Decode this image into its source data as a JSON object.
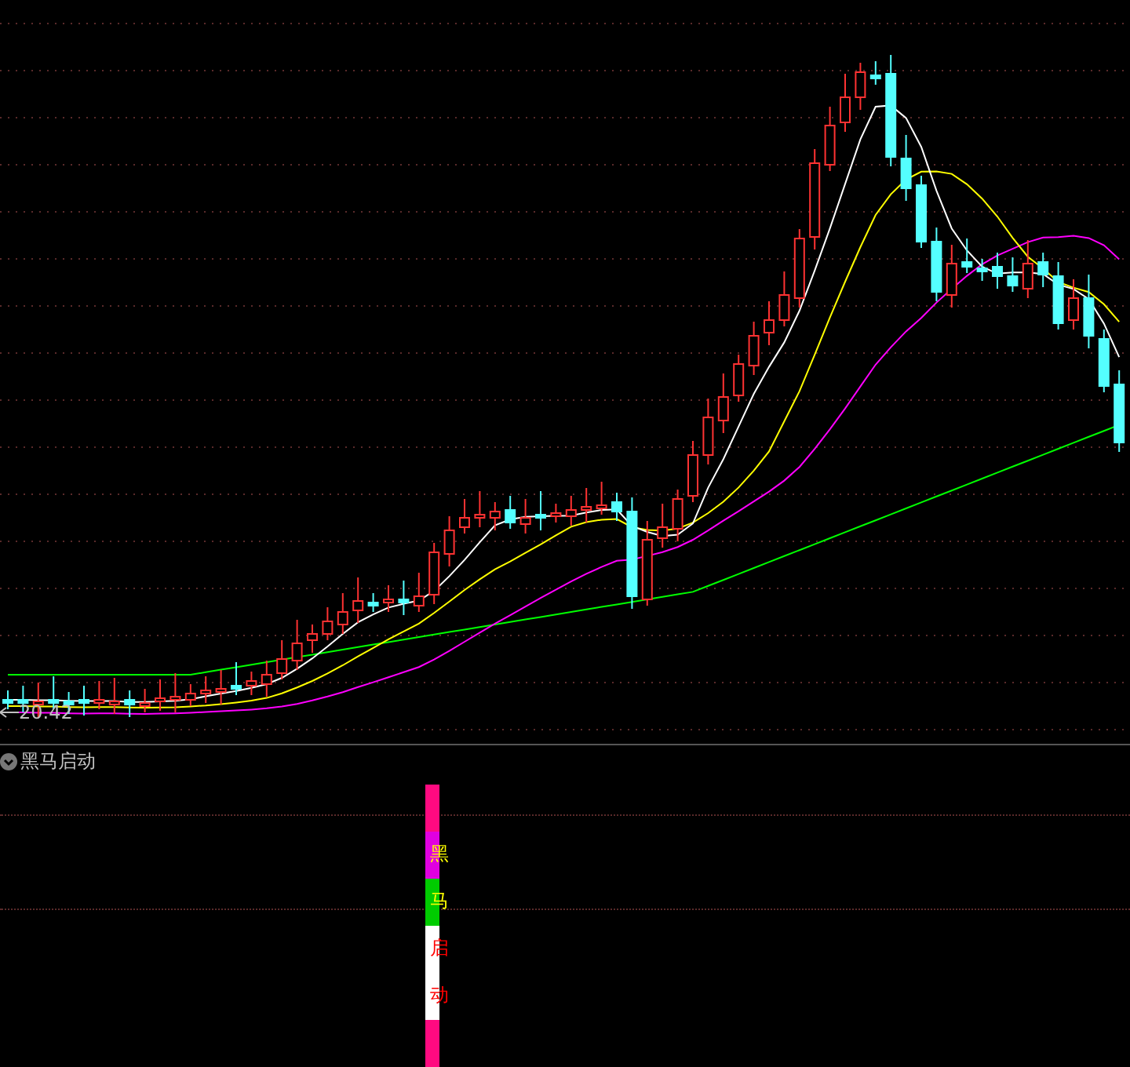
{
  "main_chart": {
    "low_price_label": "20.42"
  },
  "indicator": {
    "title": "黑马启动",
    "signal_bar": [
      {
        "color": "#ff0a80"
      },
      {
        "color": "#e000e0"
      },
      {
        "color": "#00cc00"
      },
      {
        "color": "#ffffff"
      },
      {
        "color": "#ffffff"
      },
      {
        "color": "#ff0a80"
      }
    ],
    "signal_text": [
      {
        "text": "黑",
        "color": "#ffff00"
      },
      {
        "text": "马",
        "color": "#ffff00"
      },
      {
        "text": "启",
        "color": "#ff0000"
      },
      {
        "text": "动",
        "color": "#ff0000"
      }
    ]
  }
}
